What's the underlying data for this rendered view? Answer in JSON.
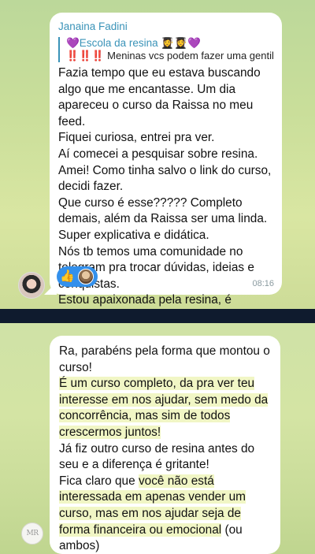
{
  "top_chat": {
    "sender_name": "Janaina Fadini",
    "reply": {
      "title": "💜Escola da resina 👩‍🎓👩‍🎓💜",
      "text": "‼️‼️‼️ Meninas vcs podem fazer uma gentil..."
    },
    "message": "Fazia tempo que eu estava buscando algo que me encantasse. Um dia apareceu o curso da Raissa no meu feed.\nFiquei curiosa, entrei pra ver.\nAí comecei a pesquisar sobre resina.\nAmei! Como tinha salvo o link do curso, decidi fazer.\nQue curso é esse????? Completo demais, além da Raissa ser uma linda.\nSuper explicativa e didática.\nNós tb temos uma comunidade no telegram pra trocar dúvidas, ideias e conquistas.\nEstou apaixonada pela resina, é viciante!",
    "reaction_emoji": "👍",
    "time": "08:16",
    "avatar_icon": "user-avatar-photo"
  },
  "bottom_chat": {
    "message_parts": [
      "Ra, parabéns pela forma que montou o curso!\n",
      "É um curso completo, da pra ver teu interesse em nos ajudar, sem medo da concorrência, mas sim de todos crescermos juntos!",
      "\nJá fiz outro curso de resina antes do seu e a diferença é gritante!\nFica claro que ",
      "você não está interessada em apenas vender um curso, mas em nos ajudar seja de forma financeira ou emocional",
      " (ou ambos)\nParabéns 🥰😘😘"
    ],
    "avatar_text": "MR"
  },
  "colors": {
    "accent": "#3a93b8",
    "reaction_bg": "#3390ec",
    "divider": "#0f1b2e"
  }
}
